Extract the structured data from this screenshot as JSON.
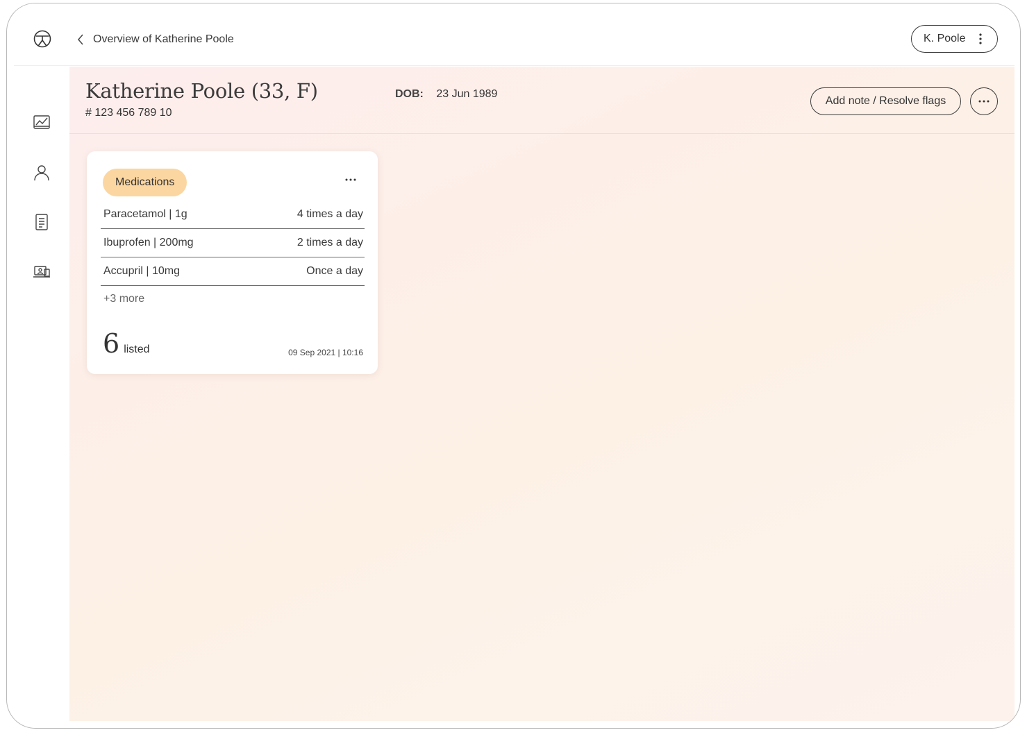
{
  "header": {
    "back_label": "Overview of Katherine Poole",
    "user_label": "K. Poole"
  },
  "sidebar": {
    "items": [
      {
        "icon": "chart-icon"
      },
      {
        "icon": "person-icon"
      },
      {
        "icon": "document-icon"
      },
      {
        "icon": "telehealth-icon"
      }
    ]
  },
  "patient": {
    "name": "Katherine Poole (33, F)",
    "id": "# 123 456 789 10",
    "dob_label": "DOB:",
    "dob": "23 Jun 1989",
    "note_button": "Add note / Resolve flags"
  },
  "medications_card": {
    "title": "Medications",
    "items": [
      {
        "name": "Paracetamol | 1g",
        "frequency": "4 times a day"
      },
      {
        "name": "Ibuprofen | 200mg",
        "frequency": "2 times a day"
      },
      {
        "name": "Accupril | 10mg",
        "frequency": "Once a day"
      }
    ],
    "more_label": "+3 more",
    "count": "6",
    "count_label": "listed",
    "timestamp": "09 Sep 2021 | 10:16"
  },
  "colors": {
    "pill": "#fcd6a0",
    "border": "#3a3a3a"
  }
}
